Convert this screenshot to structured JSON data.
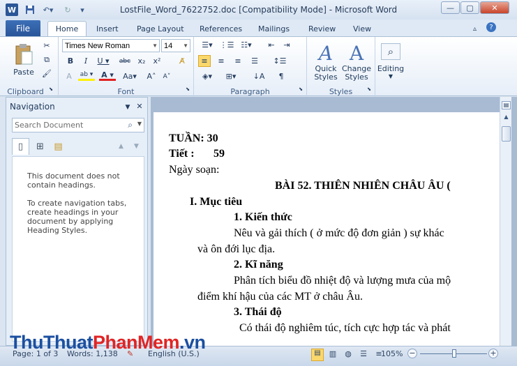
{
  "window": {
    "title": "LostFile_Word_7622752.doc [Compatibility Mode]  -  Microsoft Word",
    "app_logo": "W",
    "controls": {
      "minimize": "—",
      "maximize": "▢",
      "close": "✕"
    }
  },
  "tabs": {
    "file": "File",
    "items": [
      "Home",
      "Insert",
      "Page Layout",
      "References",
      "Mailings",
      "Review",
      "View"
    ]
  },
  "ribbon": {
    "clipboard": {
      "label": "Clipboard",
      "paste": "Paste"
    },
    "font": {
      "label": "Font",
      "name": "Times New Roman",
      "size": "14"
    },
    "paragraph": {
      "label": "Paragraph"
    },
    "styles": {
      "label": "Styles",
      "quick": "Quick\nStyles",
      "change": "Change\nStyles"
    },
    "editing": {
      "label": "Editing"
    }
  },
  "nav": {
    "title": "Navigation",
    "search_placeholder": "Search Document",
    "msg1": "This document does not contain headings.",
    "msg2": "To create navigation tabs, create headings in your document by applying Heading Styles."
  },
  "doc": {
    "l1": "TUẦN: 30",
    "l2a": "Tiết :",
    "l2b": "59",
    "l3": "Ngày soạn:",
    "l4": "BÀI 52.   THIÊN NHIÊN  CHÂU ÂU (",
    "l5": "I.   Mục tiêu",
    "l6": "1.  Kiến thức",
    "l7": "Nêu và gải thích  ( ở mức độ đơn giản ) sự khác",
    "l8": "và ôn đới lục địa.",
    "l9": "2. Kĩ năng",
    "l10": "Phân tích biểu đồ nhiệt độ và lượng mưa của mộ",
    "l11": "điểm khí hậu của các MT ở châu Âu.",
    "l12": "3.  Thái độ",
    "l13": "Có thái độ nghiêm túc, tích cực hợp tác và phát"
  },
  "status": {
    "page": "Page: 1 of 3",
    "words": "Words: 1,138",
    "lang": "English (U.S.)",
    "zoom": "105%",
    "zoom_level_percent": 105
  },
  "watermark": {
    "part1": "ThuThuat",
    "part2": "PhanMem",
    "part3": ".vn"
  },
  "colors": {
    "accent": "#2b5797",
    "wm_blue": "#1b4fa0",
    "wm_red": "#e02424"
  }
}
